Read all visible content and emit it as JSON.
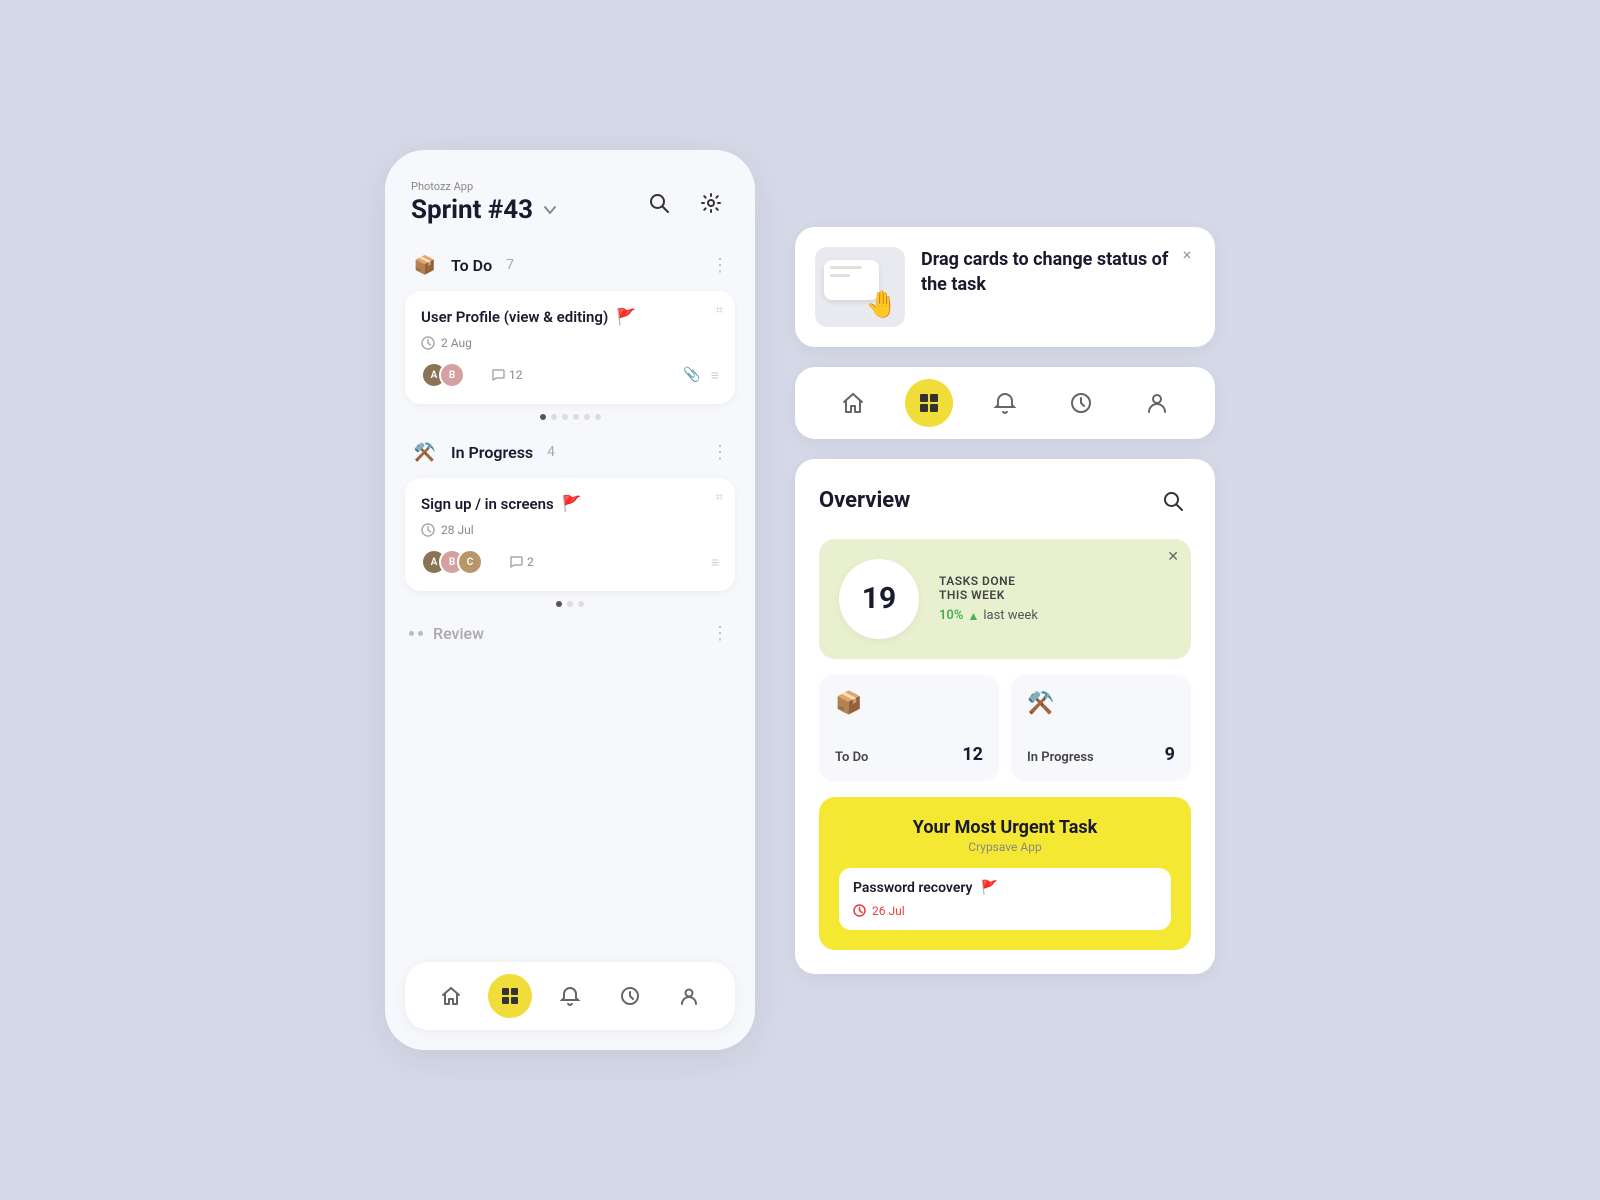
{
  "app": {
    "label": "Photozz App",
    "sprint": "Sprint #43"
  },
  "todo": {
    "title": "To Do",
    "count": "7",
    "task": {
      "name": "User Profile (view & editing)",
      "date": "2 Aug",
      "comments": "12",
      "flagColor": "red"
    }
  },
  "inProgress": {
    "title": "In Progress",
    "count": "4",
    "task": {
      "name": "Sign up / in screens",
      "date": "28 Jul",
      "comments": "2",
      "flagColor": "orange"
    }
  },
  "review": {
    "title": "Review"
  },
  "tooltip": {
    "text": "Drag cards to change status of the task",
    "closeLabel": "×"
  },
  "nav": {
    "items": [
      "home",
      "board",
      "bell",
      "activity",
      "profile"
    ]
  },
  "overview": {
    "title": "Overview",
    "tasksDone": {
      "label": "TASKS DONE",
      "sublabel": "THIS WEEK",
      "count": "19",
      "pct": "10%",
      "trend": "▲",
      "trendLabel": "last week"
    },
    "todo": {
      "label": "To Do",
      "count": "12"
    },
    "inProgress": {
      "label": "In Progress",
      "count": "9"
    }
  },
  "urgentTask": {
    "title": "Your Most Urgent Task",
    "subtitle": "Crypsave App",
    "taskName": "Password recovery",
    "taskDate": "26 Jul"
  }
}
